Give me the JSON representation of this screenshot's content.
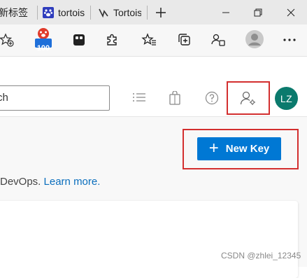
{
  "browser": {
    "tabs": [
      {
        "label": "新标签",
        "icon": "edge-icon"
      },
      {
        "label": "tortoise",
        "icon": "baidu-paw-icon"
      },
      {
        "label": "Tortoise",
        "icon": "tortoise-logo-icon"
      }
    ],
    "new_tab_icon": "plus-icon",
    "window_controls": [
      "minimize-icon",
      "restore-icon",
      "close-icon"
    ],
    "toolbar_icons": [
      "add-favorite-icon",
      "baidu-badge-icon",
      "extension-square-icon",
      "extensions-puzzle-icon",
      "favorites-icon",
      "collections-icon",
      "performance-icon",
      "profile-icon",
      "more-icon"
    ],
    "baidu_badge_count": "100"
  },
  "page": {
    "search": {
      "value": "rch",
      "placeholder": ""
    },
    "header_icons": [
      "task-list-icon",
      "shopping-bag-icon",
      "help-icon",
      "user-settings-icon"
    ],
    "avatar_initials": "LZ",
    "new_key_button": {
      "label": "New Key",
      "icon": "plus-icon"
    },
    "info_text": "DevOps.",
    "learn_more_link": "Learn more.",
    "watermark": "CSDN @zhlei_12345"
  },
  "colors": {
    "accent": "#0078d4",
    "avatar_bg": "#0b7a6d",
    "highlight_box": "#d32f2f",
    "link": "#0a6ebd"
  }
}
